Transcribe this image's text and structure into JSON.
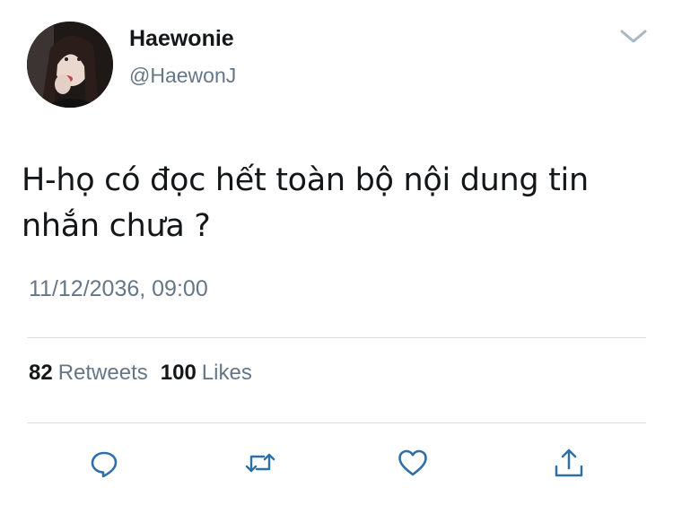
{
  "user": {
    "display_name": "Haewonie",
    "handle": "@HaewonJ"
  },
  "tweet": {
    "text": "H-họ có đọc hết toàn bộ nội dung tin nhắn chưa ?",
    "timestamp": "11/12/2036, 09:00"
  },
  "stats": {
    "retweets_count": "82",
    "retweets_label": "Retweets",
    "likes_count": "100",
    "likes_label": "Likes"
  },
  "actions": {
    "reply_icon": "reply-icon",
    "retweet_icon": "retweet-icon",
    "like_icon": "heart-icon",
    "share_icon": "share-icon"
  },
  "colors": {
    "text_primary": "#14171a",
    "text_secondary": "#657786",
    "divider": "#d8dde1"
  }
}
